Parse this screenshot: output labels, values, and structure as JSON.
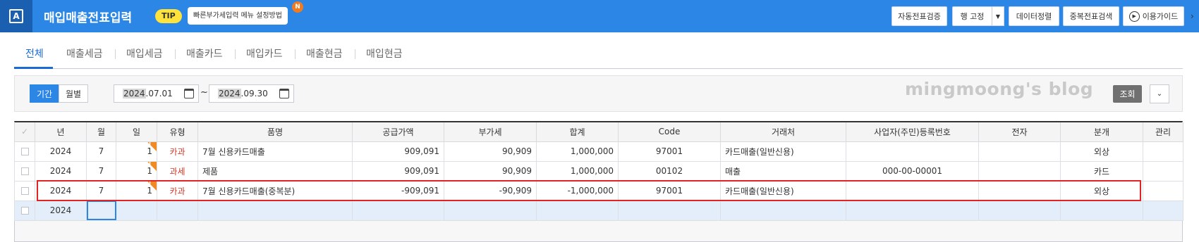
{
  "header": {
    "logo_letter": "A",
    "title": "매입매출전표입력",
    "tip_label": "TIP",
    "tip_text": "빠른부가세입력 메뉴 설정방법",
    "new_badge": "N",
    "buttons": {
      "auto_verify": "자동전표검증",
      "row_fix": "행 고정",
      "data_sort": "데이터정렬",
      "dup_search": "중복전표검색",
      "guide": "이용가이드"
    }
  },
  "tabs": [
    "전체",
    "매출세금",
    "매입세금",
    "매출카드",
    "매입카드",
    "매출현금",
    "매입현금"
  ],
  "filter": {
    "period": "기간",
    "monthly": "월별",
    "start_year": "2024",
    "start_rest": ".07.01",
    "end_year": "2024",
    "end_rest": ".09.30",
    "tilde": "~",
    "search": "조회"
  },
  "watermark": "mingmoong's blog",
  "table": {
    "columns": [
      "✓",
      "년",
      "월",
      "일",
      "유형",
      "품명",
      "공급가액",
      "부가세",
      "합계",
      "Code",
      "거래처",
      "사업자(주민)등록번호",
      "전자",
      "분개",
      "관리"
    ],
    "rows": [
      {
        "year": "2024",
        "month": "7",
        "day": "1",
        "flag": "U",
        "type": "카과",
        "item": "7월 신용카드매출",
        "supply": "909,091",
        "vat": "90,909",
        "total": "1,000,000",
        "code": "97001",
        "partner": "카드매출(일반신용)",
        "bizno": "",
        "elec": "",
        "journal": "외상",
        "mgmt": ""
      },
      {
        "year": "2024",
        "month": "7",
        "day": "1",
        "flag": "U",
        "type": "과세",
        "item": "제품",
        "supply": "909,091",
        "vat": "90,909",
        "total": "1,000,000",
        "code": "00102",
        "partner": "매출",
        "bizno": "000-00-00001",
        "elec": "",
        "journal": "카드",
        "mgmt": ""
      },
      {
        "year": "2024",
        "month": "7",
        "day": "1",
        "flag": "N",
        "type": "카과",
        "item": "7월 신용카드매출(중복분)",
        "supply": "-909,091",
        "vat": "-90,909",
        "total": "-1,000,000",
        "code": "97001",
        "partner": "카드매출(일반신용)",
        "bizno": "",
        "elec": "",
        "journal": "외상",
        "mgmt": ""
      }
    ],
    "new_row_year": "2024"
  },
  "colors": {
    "accent": "#2b86e6",
    "highlight": "#e02323",
    "flag": "#f08a24",
    "type_text": "#d23a2a"
  }
}
